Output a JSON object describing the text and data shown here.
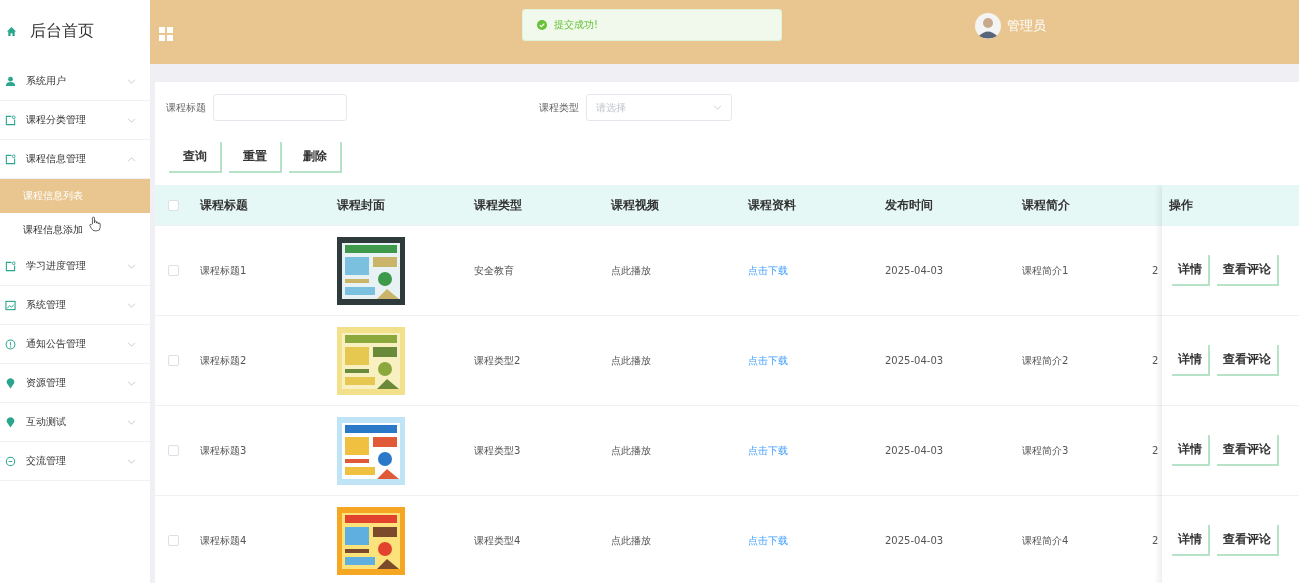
{
  "sidebar": {
    "title": "后台首页",
    "items": [
      {
        "label": "系统用户",
        "expanded": false
      },
      {
        "label": "课程分类管理",
        "expanded": false
      },
      {
        "label": "课程信息管理",
        "expanded": true,
        "children": [
          {
            "label": "课程信息列表",
            "selected": true
          },
          {
            "label": "课程信息添加",
            "selected": false
          }
        ]
      },
      {
        "label": "学习进度管理",
        "expanded": false
      },
      {
        "label": "系统管理",
        "expanded": false
      },
      {
        "label": "通知公告管理",
        "expanded": false
      },
      {
        "label": "资源管理",
        "expanded": false
      },
      {
        "label": "互动测试",
        "expanded": false
      },
      {
        "label": "交流管理",
        "expanded": false
      }
    ]
  },
  "header": {
    "toast": "提交成功!",
    "user": "管理员"
  },
  "filters": [
    {
      "label": "课程标题",
      "kind": "input"
    },
    {
      "label": "课程类型",
      "kind": "select",
      "placeholder": "请选择"
    }
  ],
  "buttons": [
    "查询",
    "重置",
    "删除"
  ],
  "table": {
    "header_checked": false,
    "columns": [
      {
        "label": "课程标题",
        "kind": "text"
      },
      {
        "label": "课程封面",
        "kind": "picture"
      },
      {
        "label": "课程类型",
        "kind": "text"
      },
      {
        "label": "课程视频",
        "kind": "text"
      },
      {
        "label": "课程资料",
        "kind": "link"
      },
      {
        "label": "发布时间",
        "kind": "text"
      },
      {
        "label": "课程简介",
        "kind": "text"
      },
      {
        "kind": "text"
      }
    ],
    "actions_label": "操作",
    "rows": [
      {
        "checked": false,
        "cells": [
          "课程标题1",
          "",
          "安全教育",
          "点此播放",
          "点击下载",
          "2025-04-03",
          "课程简介1",
          "2"
        ],
        "actions": [
          "详情",
          "查看评论"
        ]
      },
      {
        "checked": false,
        "cells": [
          "课程标题2",
          "",
          "课程类型2",
          "点此播放",
          "点击下载",
          "2025-04-03",
          "课程简介2",
          "2"
        ],
        "actions": [
          "详情",
          "查看评论"
        ]
      },
      {
        "checked": false,
        "cells": [
          "课程标题3",
          "",
          "课程类型3",
          "点此播放",
          "点击下载",
          "2025-04-03",
          "课程简介3",
          "2"
        ],
        "actions": [
          "详情",
          "查看评论"
        ]
      },
      {
        "checked": false,
        "cells": [
          "课程标题4",
          "",
          "课程类型4",
          "点此播放",
          "点击下载",
          "2025-04-03",
          "课程简介4",
          "2"
        ],
        "actions": [
          "详情",
          "查看评论"
        ]
      }
    ]
  }
}
